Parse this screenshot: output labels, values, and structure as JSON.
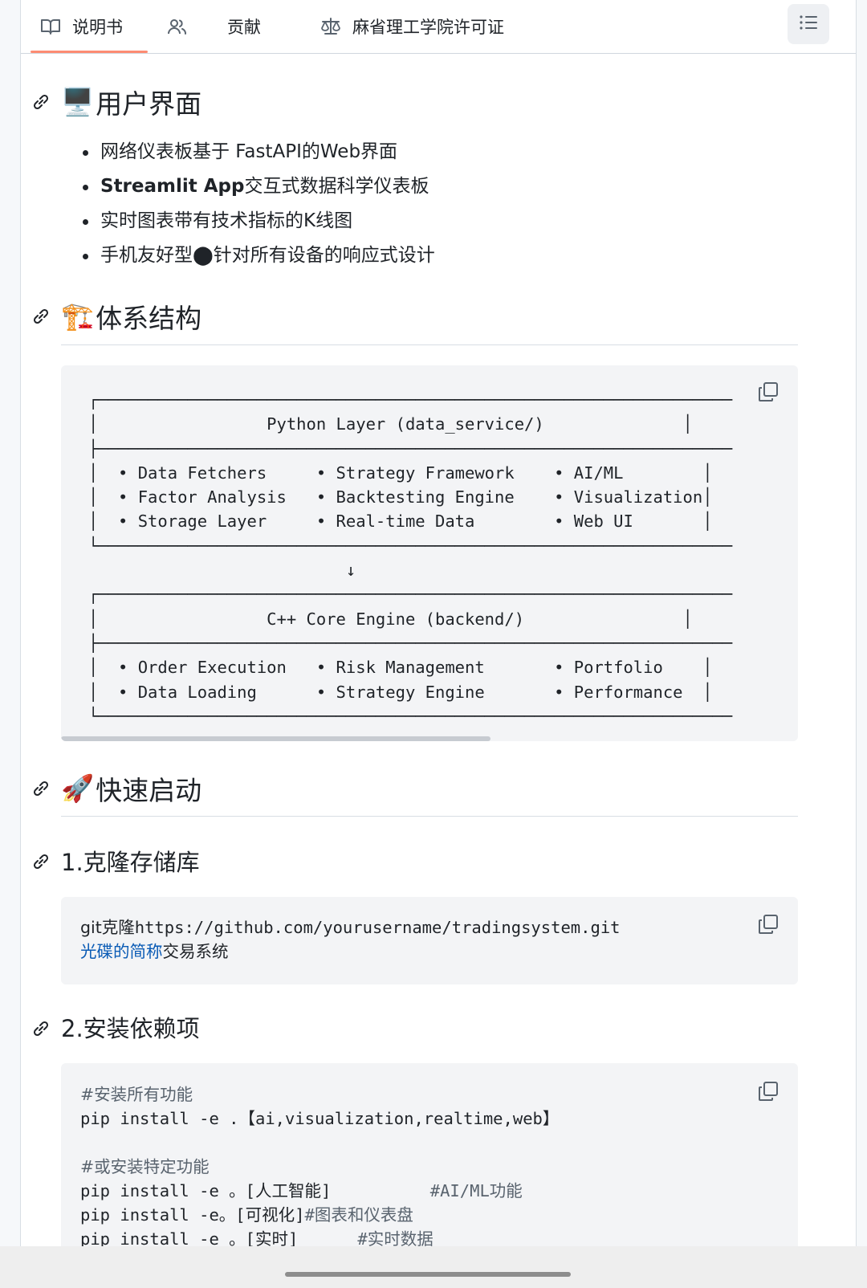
{
  "tabs": [
    {
      "label": "说明书",
      "icon": "book-icon",
      "active": true
    },
    {
      "label": "",
      "icon": "people-icon",
      "active": false
    },
    {
      "label": "贡献",
      "icon": "",
      "active": false
    },
    {
      "label": "麻省理工学院许可证",
      "icon": "law-icon",
      "active": false
    }
  ],
  "outline_icon": "list-unordered-icon",
  "ui_section": {
    "emoji": "🖥️",
    "title": "用户界面",
    "items": [
      {
        "bold": "",
        "text": "网络仪表板基于 FastAPI的Web界面"
      },
      {
        "bold": "Streamlit App",
        "text": "交互式数据科学仪表板"
      },
      {
        "bold": "",
        "text": "实时图表带有技术指标的K线图"
      },
      {
        "bold": "",
        "text": "手机友好型⬤针对所有设备的响应式设计"
      }
    ]
  },
  "arch_section": {
    "emoji": "🏗️",
    "title": "体系结构",
    "diagram": "┌────────────────────────────────────────────────────────────────\n│                 Python Layer (data_service/)              │\n├────────────────────────────────────────────────────────────────\n│  • Data Fetchers     • Strategy Framework    • AI/ML        │\n│  • Factor Analysis   • Backtesting Engine    • Visualization│\n│  • Storage Layer     • Real-time Data        • Web UI       │\n└────────────────────────────────────────────────────────────────\n                          ↓\n┌────────────────────────────────────────────────────────────────\n│                 C++ Core Engine (backend/)                │\n├────────────────────────────────────────────────────────────────\n│  • Order Execution   • Risk Management       • Portfolio    │\n│  • Data Loading      • Strategy Engine       • Performance  │\n└────────────────────────────────────────────────────────────────"
  },
  "quick_section": {
    "emoji": "🚀",
    "title": "快速启动"
  },
  "step1": {
    "title": "1.克隆存储库",
    "line1_prefix": "git克隆",
    "line1_url": "https://github.com/yourusername/tradingsystem.git",
    "line2_link": "光碟的简称",
    "line2_text": "交易系统"
  },
  "step2": {
    "title": "2.安装依赖项",
    "comment1": "#安装所有功能",
    "cmd1": "pip install -e .【ai,visualization,realtime,web】",
    "comment2": "#或安装特定功能",
    "cmd2": "pip install -e 。[人工智能]          ",
    "cmd2_comment": "#AI/ML功能",
    "cmd3": "pip install -e。[可视化]",
    "cmd3_comment": "#图表和仪表盘",
    "cmd4": "pip install -e 。[实时]      ",
    "cmd4_comment": "#实时数据"
  }
}
